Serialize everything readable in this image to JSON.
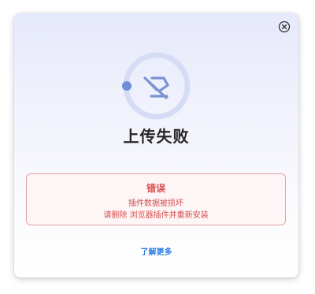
{
  "dialog": {
    "title": "上传失败",
    "close_icon": "close-circle-icon",
    "status_icon": "upload-cancelled-icon",
    "error": {
      "title": "错误",
      "line1": "插件数据被损坏",
      "line2": "请删除 浏览器插件并重新安装"
    },
    "learn_more": "了解更多"
  },
  "colors": {
    "error": "#d84e4e",
    "link": "#2b7de1",
    "accent": "#6e8ed6",
    "ring": "#d6dcf5"
  }
}
